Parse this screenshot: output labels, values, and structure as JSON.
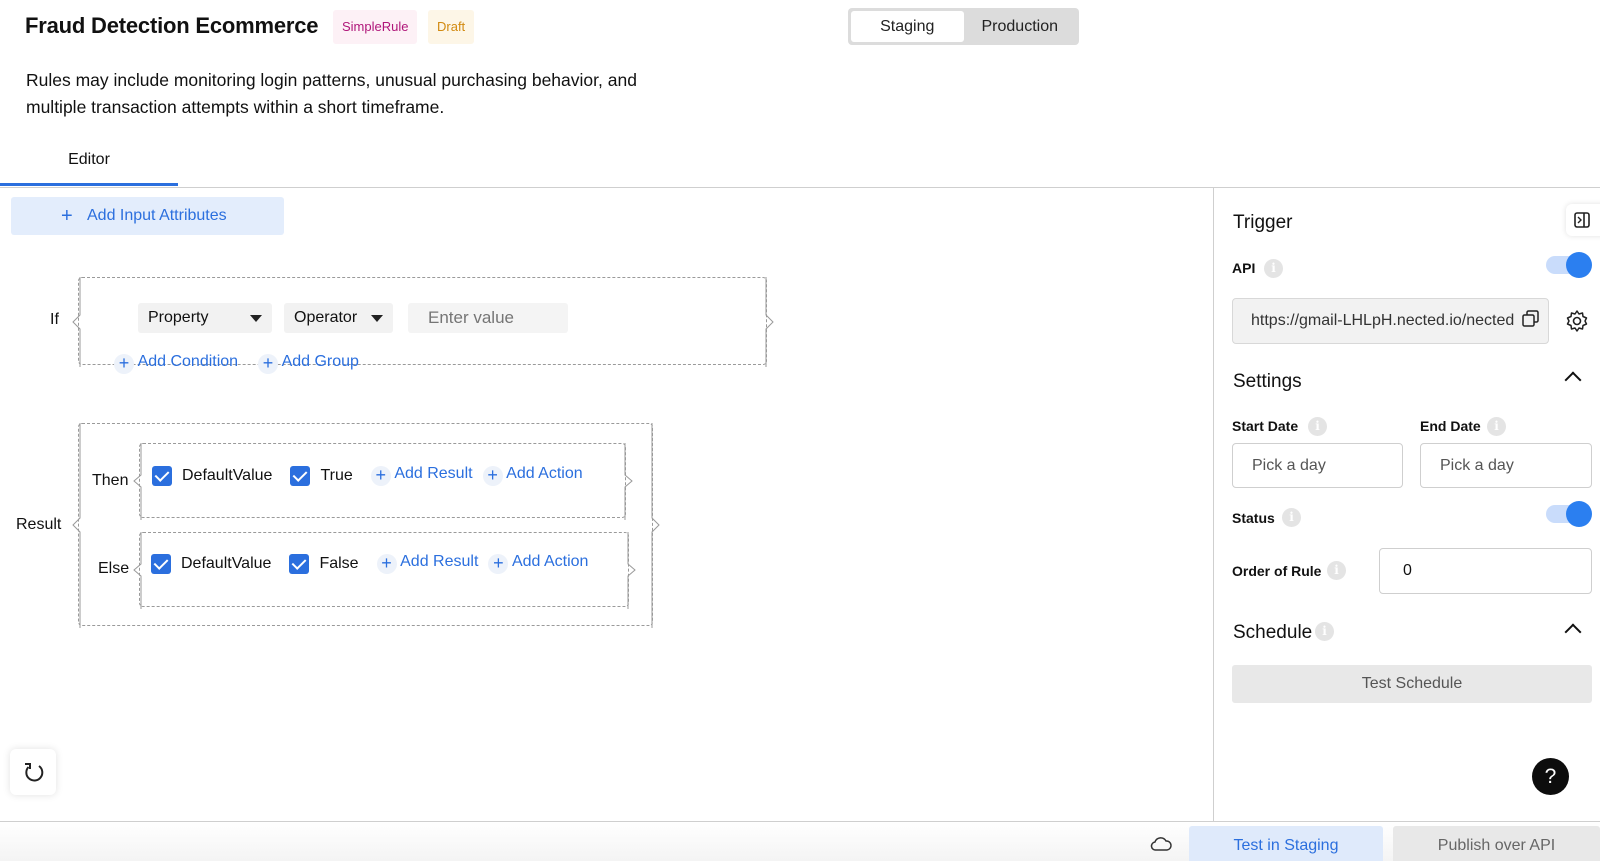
{
  "header": {
    "title": "Fraud Detection Ecommerce",
    "badges": {
      "type": "SimpleRule",
      "status": "Draft"
    },
    "env": {
      "staging": "Staging",
      "production": "Production"
    },
    "description": "Rules may include monitoring login patterns, unusual purchasing behavior, and multiple transaction attempts within a short timeframe."
  },
  "tabs": {
    "editor": "Editor"
  },
  "editor": {
    "add_input_attributes": "Add Input Attributes",
    "if_label": "If",
    "condition": {
      "property": "Property",
      "operator": "Operator",
      "value_placeholder": "Enter value"
    },
    "add_condition": "Add Condition",
    "add_group": "Add Group",
    "result_label": "Result",
    "then": {
      "label": "Then",
      "default_value": "DefaultValue",
      "value": "True",
      "add_result": "Add Result",
      "add_action": "Add Action"
    },
    "else": {
      "label": "Else",
      "default_value": "DefaultValue",
      "value": "False",
      "add_result": "Add Result",
      "add_action": "Add Action"
    }
  },
  "sidebar": {
    "trigger_title": "Trigger",
    "api_label": "API",
    "api_enabled": true,
    "api_url": "https://gmail-LHLpH.nected.io/nected",
    "settings_title": "Settings",
    "start_date_label": "Start Date",
    "end_date_label": "End Date",
    "start_date_placeholder": "Pick a day",
    "end_date_placeholder": "Pick a day",
    "status_label": "Status",
    "status_enabled": true,
    "order_label": "Order of Rule",
    "order_value": "0",
    "schedule_title": "Schedule",
    "test_schedule": "Test Schedule"
  },
  "footer": {
    "test_in_staging": "Test in Staging",
    "publish_over_api": "Publish over API"
  },
  "icons": {
    "help": "?",
    "plus": "+",
    "info": "i"
  },
  "colors": {
    "accent": "#2b6fde",
    "toggle_on": "#2b7ff0",
    "badge_simple": "#b0177a",
    "badge_draft": "#d28a10"
  }
}
